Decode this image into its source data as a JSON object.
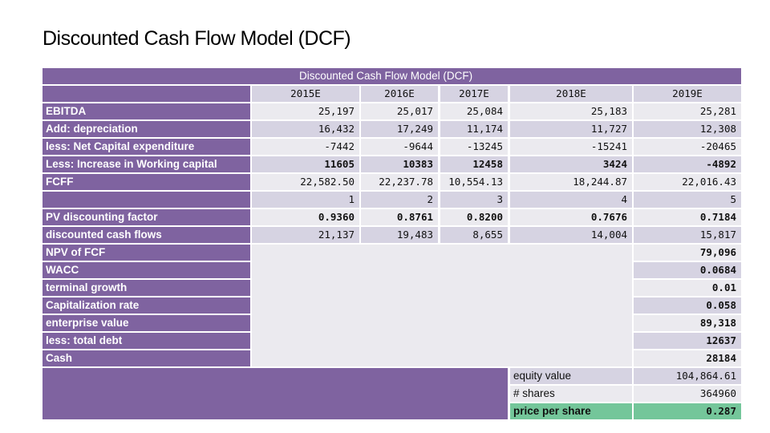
{
  "slide": {
    "title": "Discounted Cash Flow Model (DCF)"
  },
  "table": {
    "caption": "Discounted Cash Flow Model (DCF)",
    "years": [
      "2015E",
      "2016E",
      "2017E",
      "2018E",
      "2019E"
    ],
    "rows": [
      {
        "label": "EBITDA",
        "values": [
          "25,197",
          "25,017",
          "25,084",
          "25,183",
          "25,281"
        ]
      },
      {
        "label": "Add: depreciation",
        "values": [
          "16,432",
          "17,249",
          "11,174",
          "11,727",
          "12,308"
        ]
      },
      {
        "label": "less: Net Capital expenditure",
        "values": [
          "-7442",
          "-9644",
          "-13245",
          "-15241",
          "-20465"
        ]
      },
      {
        "label": "Less:  Increase in Working capital",
        "values": [
          "11605",
          "10383",
          "12458",
          "3424",
          "-4892"
        ]
      },
      {
        "label": "FCFF",
        "values": [
          "22,582.50",
          "22,237.78",
          "10,554.13",
          "18,244.87",
          "22,016.43"
        ]
      },
      {
        "label": "",
        "values": [
          "1",
          "2",
          "3",
          "4",
          "5"
        ]
      },
      {
        "label": "PV discounting factor",
        "values": [
          "0.9360",
          "0.8761",
          "0.8200",
          "0.7676",
          "0.7184"
        ]
      },
      {
        "label": "discounted cash flows",
        "values": [
          "21,137",
          "19,483",
          "8,655",
          "14,004",
          "15,817"
        ]
      }
    ],
    "summary": [
      {
        "label": "NPV of FCF",
        "value": "79,096"
      },
      {
        "label": "WACC",
        "value": "0.0684"
      },
      {
        "label": "terminal growth",
        "value": "0.01"
      },
      {
        "label": "Capitalization rate",
        "value": "0.058"
      },
      {
        "label": "enterprise value",
        "value": "89,318"
      },
      {
        "label": "less: total debt",
        "value": "12637"
      },
      {
        "label": "Cash",
        "value": "28184"
      }
    ],
    "equity": [
      {
        "label": "equity value",
        "value": "104,864.61"
      },
      {
        "label": "# shares",
        "value": "364960"
      },
      {
        "label": "price per share",
        "value": "0.287"
      }
    ]
  },
  "colors": {
    "header_purple": "#7f63a0",
    "band_dark": "#d6d3e2",
    "band_light": "#ebeaef",
    "highlight_green": "#74c69a"
  }
}
